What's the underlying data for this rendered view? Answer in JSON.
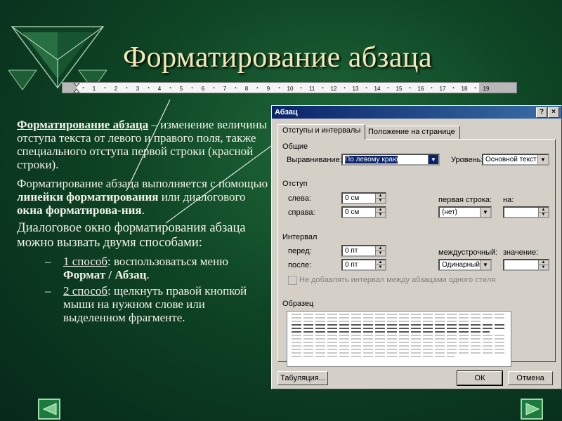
{
  "slide": {
    "title": "Форматирование абзаца",
    "ruler_numbers": [
      "1",
      "2",
      "3",
      "4",
      "5",
      "6",
      "7",
      "8",
      "9",
      "10",
      "11",
      "12",
      "13",
      "14",
      "15",
      "16",
      "17",
      "18",
      "19"
    ],
    "p1": {
      "term": "Форматирование абзаца",
      "rest": " – изменение величины отступа текста от левого и правого поля,  также специального отступа первой строки (красной строки)."
    },
    "p2": {
      "a": "Форматирование абзаца выполняется с помощью ",
      "b": "линейки форматирования",
      "c": " или диалогового ",
      "d": "окна форматирова-ния",
      "e": "."
    },
    "p3": "Диалоговое окно форматирования абзаца можно вызвать двумя способами:",
    "bullets": [
      {
        "dash": "–",
        "label": "1 способ",
        "a": ":  воспользоваться меню ",
        "b": "Формат / Абзац",
        "c": "."
      },
      {
        "dash": "–",
        "label": "2 способ",
        "a": ": щелкнуть правой кнопкой мыши на нужном слове или выделенном фрагменте.",
        "b": "",
        "c": ""
      }
    ]
  },
  "dialog": {
    "title": "Абзац",
    "help_btn": "?",
    "close_btn": "×",
    "tabs": [
      "Отступы и интервалы",
      "Положение на странице"
    ],
    "general": {
      "group": "Общие",
      "align_label": "Выравнивание:",
      "align_value": "По левому краю",
      "level_label": "Уровень:",
      "level_value": "Основной текст"
    },
    "indent": {
      "group": "Отступ",
      "left_label": "слева:",
      "left_value": "0 см",
      "right_label": "справа:",
      "right_value": "0 см",
      "first_label": "первая строка:",
      "first_value": "(нет)",
      "on_label": "на:",
      "on_value": ""
    },
    "spacing": {
      "group": "Интервал",
      "before_label": "перед:",
      "before_value": "0 пт",
      "after_label": "после:",
      "after_value": "0 пт",
      "line_label": "междустрочный:",
      "line_value": "Одинарный",
      "value_label": "значение:",
      "value_value": "",
      "no_space_label": "Не добавлять интервал между абзацами одного стиля"
    },
    "sample_group": "Образец",
    "tab_button": "Табуляция...",
    "ok": "ОК",
    "cancel": "Отмена"
  }
}
